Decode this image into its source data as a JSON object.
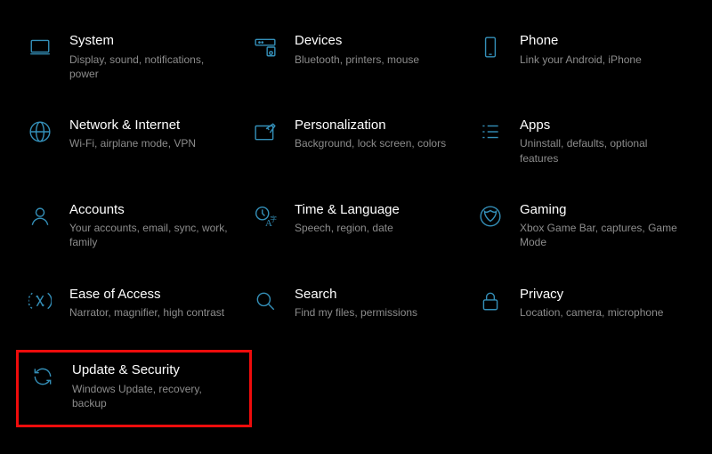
{
  "colors": {
    "icon": "#348fb8",
    "highlight_border": "#ee0c0c"
  },
  "tiles": [
    {
      "key": "system",
      "title": "System",
      "desc": "Display, sound, notifications, power"
    },
    {
      "key": "devices",
      "title": "Devices",
      "desc": "Bluetooth, printers, mouse"
    },
    {
      "key": "phone",
      "title": "Phone",
      "desc": "Link your Android, iPhone"
    },
    {
      "key": "network",
      "title": "Network & Internet",
      "desc": "Wi-Fi, airplane mode, VPN"
    },
    {
      "key": "personalization",
      "title": "Personalization",
      "desc": "Background, lock screen, colors"
    },
    {
      "key": "apps",
      "title": "Apps",
      "desc": "Uninstall, defaults, optional features"
    },
    {
      "key": "accounts",
      "title": "Accounts",
      "desc": "Your accounts, email, sync, work, family"
    },
    {
      "key": "time",
      "title": "Time & Language",
      "desc": "Speech, region, date"
    },
    {
      "key": "gaming",
      "title": "Gaming",
      "desc": "Xbox Game Bar, captures, Game Mode"
    },
    {
      "key": "ease",
      "title": "Ease of Access",
      "desc": "Narrator, magnifier, high contrast"
    },
    {
      "key": "search",
      "title": "Search",
      "desc": "Find my files, permissions"
    },
    {
      "key": "privacy",
      "title": "Privacy",
      "desc": "Location, camera, microphone"
    },
    {
      "key": "update",
      "title": "Update & Security",
      "desc": "Windows Update, recovery, backup",
      "highlighted": true
    }
  ]
}
